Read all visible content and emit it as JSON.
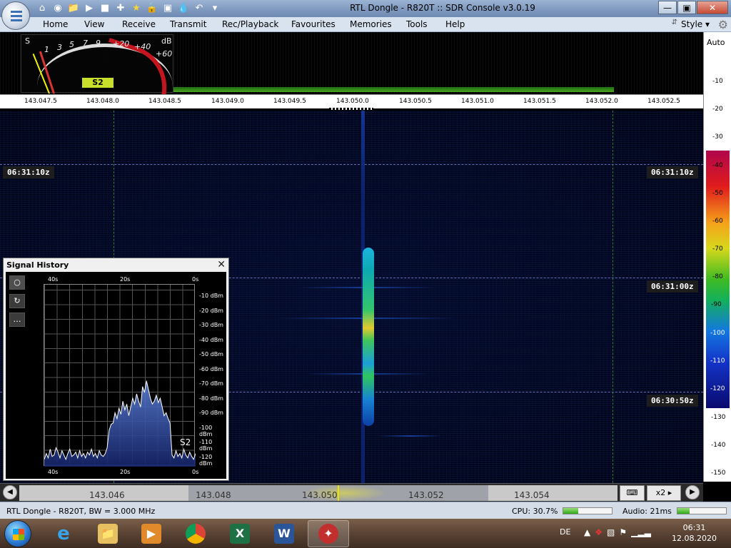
{
  "window": {
    "title": "RTL Dongle - R820T :: SDR Console v3.0.19",
    "minimize": "—",
    "restore": "▣",
    "close": "✕"
  },
  "quick_access": [
    "home-icon",
    "help-ring-icon",
    "folder-icon",
    "play-icon",
    "stop-icon",
    "plus-icon",
    "star-icon",
    "lock-icon",
    "camera-icon",
    "drop-icon",
    "undo-icon",
    "dropdown-icon"
  ],
  "menu": {
    "items": [
      "Home",
      "View",
      "Receive",
      "Transmit",
      "Rec/Playback",
      "Favourites",
      "Memories",
      "Tools",
      "Help"
    ],
    "style_label": "Style"
  },
  "smeter": {
    "s_label": "S",
    "db_label": "dB",
    "scale_left": [
      "1",
      "3",
      "5",
      "7",
      "9"
    ],
    "scale_right": [
      "+20",
      "+40",
      "+60"
    ],
    "reading": "S2"
  },
  "frequency_scale": [
    "143.047.5",
    "143.048.0",
    "143.048.5",
    "143.049.0",
    "143.049.5",
    "143.050.0",
    "143.050.5",
    "143.051.0",
    "143.051.5",
    "143.052.0",
    "143.052.5"
  ],
  "waterfall": {
    "timestamps": [
      "06:31:10z",
      "06:31:00z",
      "06:30:50z"
    ]
  },
  "db_scale": {
    "auto_label": "Auto",
    "upper_labels": [
      "-10",
      "-20",
      "-30"
    ],
    "colorbar_labels": [
      "-40",
      "-50",
      "-60",
      "-70",
      "-80",
      "-90",
      "-100",
      "-110",
      "-120"
    ],
    "lower_labels": [
      "-130",
      "-140",
      "-150"
    ]
  },
  "signal_history": {
    "title": "Signal History",
    "close": "✕",
    "time_top": [
      "40s",
      "20s",
      "0s"
    ],
    "time_bottom": [
      "40s",
      "20s",
      "0s"
    ],
    "db_labels": [
      "-10 dBm",
      "-20 dBm",
      "-30 dBm",
      "-40 dBm",
      "-50 dBm",
      "-60 dBm",
      "-70 dBm",
      "-80 dBm",
      "-90 dBm",
      "-100 dBm",
      "-110 dBm",
      "-120 dBm"
    ],
    "reading": "S2",
    "buttons": [
      "○",
      "↻",
      "…"
    ],
    "trace_dbm": [
      -120,
      -116,
      -119,
      -113,
      -118,
      -117,
      -112,
      -115,
      -119,
      -114,
      -117,
      -120,
      -116,
      -113,
      -118,
      -117,
      -115,
      -119,
      -114,
      -118,
      -116,
      -119,
      -115,
      -117,
      -113,
      -118,
      -116,
      -119,
      -114,
      -117,
      -118,
      -116,
      -112,
      -100,
      -96,
      -95,
      -88,
      -92,
      -85,
      -89,
      -80,
      -86,
      -82,
      -90,
      -84,
      -78,
      -82,
      -75,
      -80,
      -84,
      -70,
      -74,
      -66,
      -72,
      -78,
      -82,
      -80,
      -76,
      -81,
      -78,
      -84,
      -90,
      -88,
      -92,
      -95,
      -117,
      -119,
      -114,
      -118,
      -116,
      -119,
      -113,
      -117,
      -119,
      -115,
      -118,
      -120,
      -116
    ]
  },
  "tuner": {
    "labels": [
      "143.046",
      "143.048",
      "143.050",
      "143.052",
      "143.054"
    ],
    "zoom": "x2",
    "left_nav": "◀",
    "right_nav": "▶",
    "keyboard_icon": "keyboard-icon"
  },
  "status": {
    "device": "RTL Dongle - R820T, BW = 3.000 MHz",
    "cpu_label": "CPU: 30.7%",
    "audio_label": "Audio: 21ms",
    "cpu_level": 0.307,
    "audio_level": 0.25
  },
  "taskbar": {
    "apps": [
      "internet-explorer-icon",
      "file-explorer-icon",
      "media-player-icon",
      "chrome-icon",
      "excel-icon",
      "word-icon",
      "sdr-console-icon"
    ],
    "language": "DE",
    "time": "06:31",
    "date": "12.08.2020"
  },
  "colors": {
    "accent_green": "#3fa51f",
    "smeter_badge": "#c8df2b",
    "signal_peak": "#e3c92e"
  }
}
